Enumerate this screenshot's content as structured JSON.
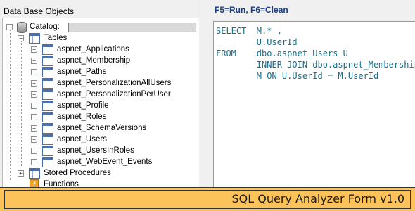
{
  "left_panel": {
    "title": "Data Base Objects",
    "catalog_label": "Catalog:",
    "tables_label": "Tables",
    "tables": [
      "aspnet_Applications",
      "aspnet_Membership",
      "aspnet_Paths",
      "aspnet_PersonalizationAllUsers",
      "aspnet_PersonalizationPerUser",
      "aspnet_Profile",
      "aspnet_Roles",
      "aspnet_SchemaVersions",
      "aspnet_Users",
      "aspnet_UsersInRoles",
      "aspnet_WebEvent_Events"
    ],
    "stored_procedures_label": "Stored Procedures",
    "functions_label": "Functions"
  },
  "right_panel": {
    "shortcut_hint": "F5=Run, F6=Clean",
    "query_lines": [
      "SELECT  M.* ,",
      "        U.UserId",
      "FROM    dbo.aspnet_Users U",
      "        INNER JOIN dbo.aspnet_Membership",
      "        M ON U.UserId = M.UserId"
    ]
  },
  "banner": {
    "text": "SQL Query Analyzer Form v1.0"
  },
  "colors": {
    "banner": "#fbc35a",
    "code": "#166f8b",
    "hint": "#1a3f8b"
  }
}
